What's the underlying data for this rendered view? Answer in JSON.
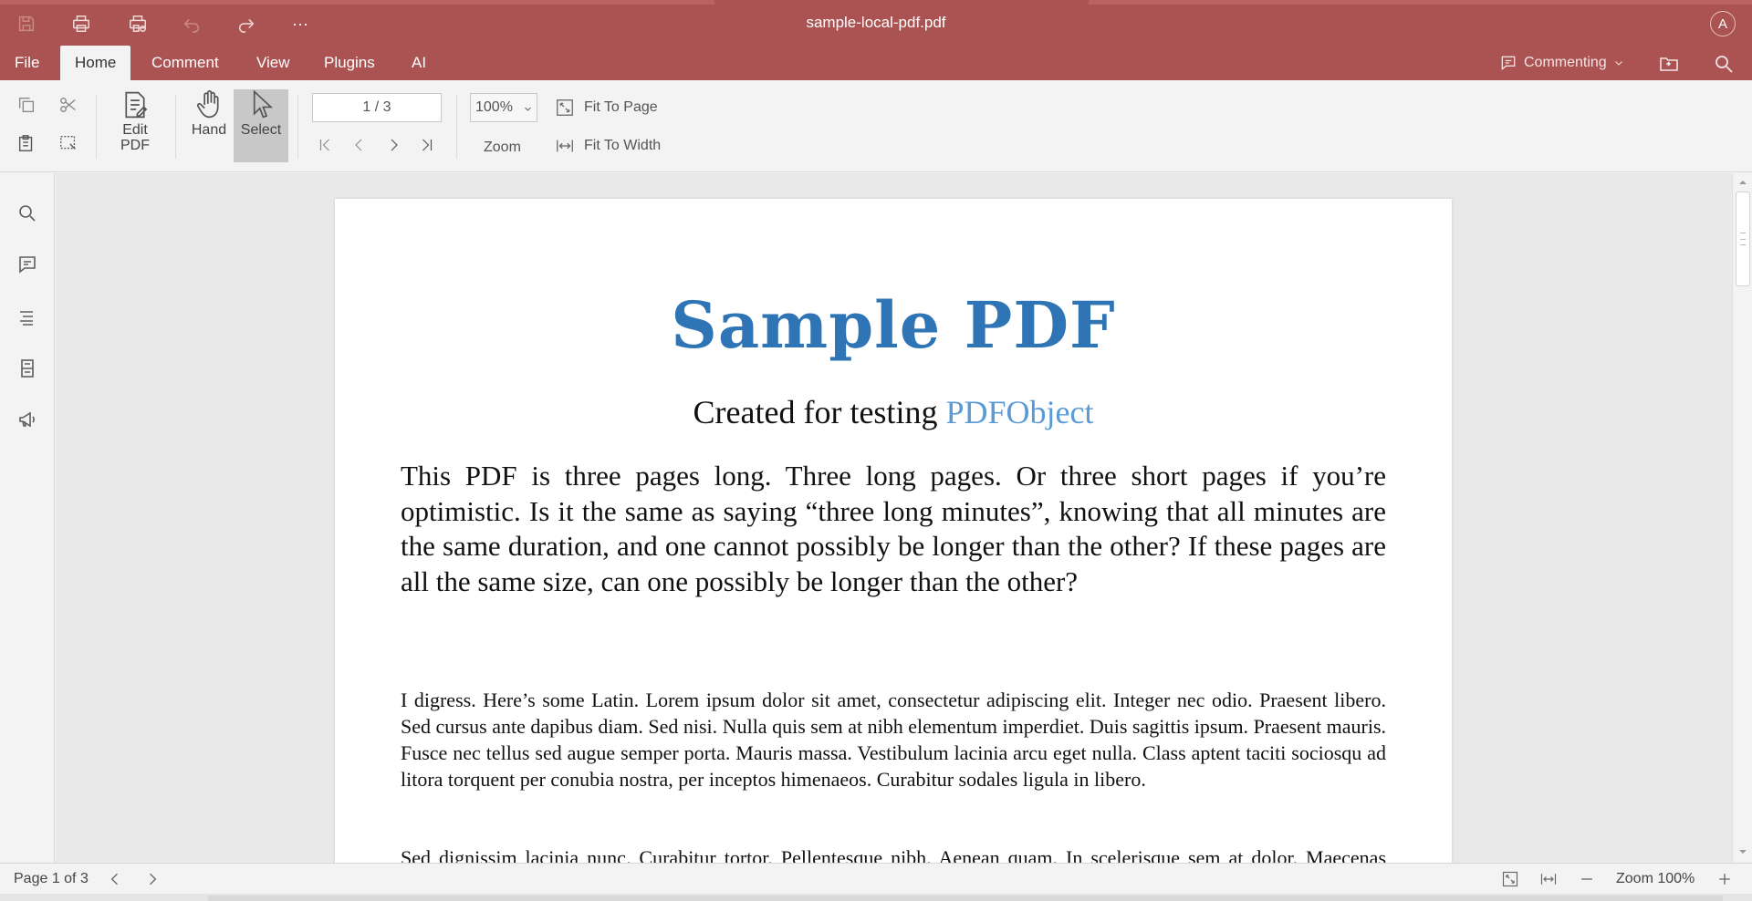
{
  "window": {
    "title": "sample-local-pdf.pdf",
    "avatar_initial": "A"
  },
  "quick_access": {
    "icons": [
      "save-icon",
      "print-icon",
      "print-settings-icon",
      "undo-icon",
      "redo-icon",
      "more-icon"
    ],
    "more_label": "···"
  },
  "menu": {
    "items": [
      "File",
      "Home",
      "Comment",
      "View",
      "Plugins",
      "AI"
    ],
    "active": "Home",
    "mode_label": "Commenting"
  },
  "ribbon": {
    "edit_pdf_label": "Edit\nPDF",
    "edit_pdf_line1": "Edit",
    "edit_pdf_line2": "PDF",
    "hand_label": "Hand",
    "select_label": "Select",
    "page_value": "1 / 3",
    "zoom_value": "100%",
    "zoom_label": "Zoom",
    "fit_to_page_label": "Fit To Page",
    "fit_to_width_label": "Fit To Width"
  },
  "sidebar": {
    "icons": [
      "search-icon",
      "comment-icon",
      "outline-icon",
      "thumbnails-icon",
      "announcement-icon"
    ]
  },
  "document": {
    "title": "Sample PDF",
    "subtitle_prefix": "Created for testing ",
    "subtitle_link": "PDFObject",
    "lead": "This PDF is three pages long. Three long pages. Or three short pages if you’re optimistic. Is it the same as saying “three long minutes”, knowing that all minutes are the same duration, and one cannot possibly be longer than the other? If these pages are all the same size, can one possibly be longer than the other?",
    "paragraph1": "I digress. Here’s some Latin. Lorem ipsum dolor sit amet, consectetur adipiscing elit. Integer nec odio. Praesent libero. Sed cursus ante dapibus diam. Sed nisi. Nulla quis sem at nibh elementum imperdiet. Duis sagittis ipsum. Praesent mauris. Fusce nec tellus sed augue semper porta. Mauris massa. Vestibulum lacinia arcu eget nulla. Class aptent taciti sociosqu ad litora torquent per conubia nostra, per inceptos himenaeos. Curabitur sodales ligula in libero.",
    "paragraph2": "Sed dignissim lacinia nunc. Curabitur tortor. Pellentesque nibh. Aenean quam. In scelerisque sem at dolor. Maecenas mattis. Sed convallis tristique sem. Proin ut ligula vel nunc egestas porttitor."
  },
  "status": {
    "page_text": "Page 1 of 3",
    "zoom_text": "Zoom 100%"
  },
  "colors": {
    "accent": "#ab5353",
    "title_blue": "#2f75b5",
    "link_blue": "#5b9bd5"
  }
}
